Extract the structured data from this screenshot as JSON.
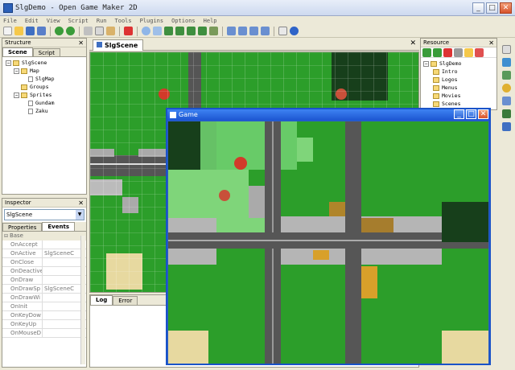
{
  "window": {
    "title": "SlgDemo - Open Game Maker 2D"
  },
  "menu": [
    "File",
    "Edit",
    "View",
    "Script",
    "Run",
    "Tools",
    "Plugins",
    "Options",
    "Help"
  ],
  "structure": {
    "title": "Structure",
    "tabs": [
      "Scene",
      "Script"
    ],
    "tree": [
      {
        "label": "SlgScene",
        "level": 0,
        "kind": "folder"
      },
      {
        "label": "Map",
        "level": 1,
        "kind": "folder"
      },
      {
        "label": "SlgMap",
        "level": 2,
        "kind": "doc"
      },
      {
        "label": "Groups",
        "level": 1,
        "kind": "folder"
      },
      {
        "label": "Sprites",
        "level": 1,
        "kind": "folder"
      },
      {
        "label": "Gundam",
        "level": 2,
        "kind": "doc"
      },
      {
        "label": "Zaku",
        "level": 2,
        "kind": "doc"
      }
    ]
  },
  "editor": {
    "tab": "SlgScene"
  },
  "inspector": {
    "title": "Inspector",
    "object": "SlgScene",
    "tabs": [
      "Properties",
      "Events"
    ],
    "section": "Base",
    "rows": [
      [
        "OnAccept",
        ""
      ],
      [
        "OnActive",
        "SlgSceneC"
      ],
      [
        "OnClose",
        ""
      ],
      [
        "OnDeactive",
        ""
      ],
      [
        "OnDraw",
        ""
      ],
      [
        "OnDrawSp",
        "SlgSceneC"
      ],
      [
        "OnDrawWi",
        ""
      ],
      [
        "OnInit",
        ""
      ],
      [
        "OnKeyDow",
        ""
      ],
      [
        "OnKeyUp",
        ""
      ],
      [
        "OnMouseD",
        ""
      ]
    ]
  },
  "log": {
    "tabs": [
      "Log",
      "Error"
    ]
  },
  "resource": {
    "title": "Resource",
    "tree": [
      {
        "label": "SlgDemo",
        "level": 0
      },
      {
        "label": "Intro",
        "level": 1
      },
      {
        "label": "Logos",
        "level": 1
      },
      {
        "label": "Menus",
        "level": 1
      },
      {
        "label": "Movies",
        "level": 1
      },
      {
        "label": "Scenes",
        "level": 1
      }
    ]
  },
  "game": {
    "title": "Game"
  }
}
